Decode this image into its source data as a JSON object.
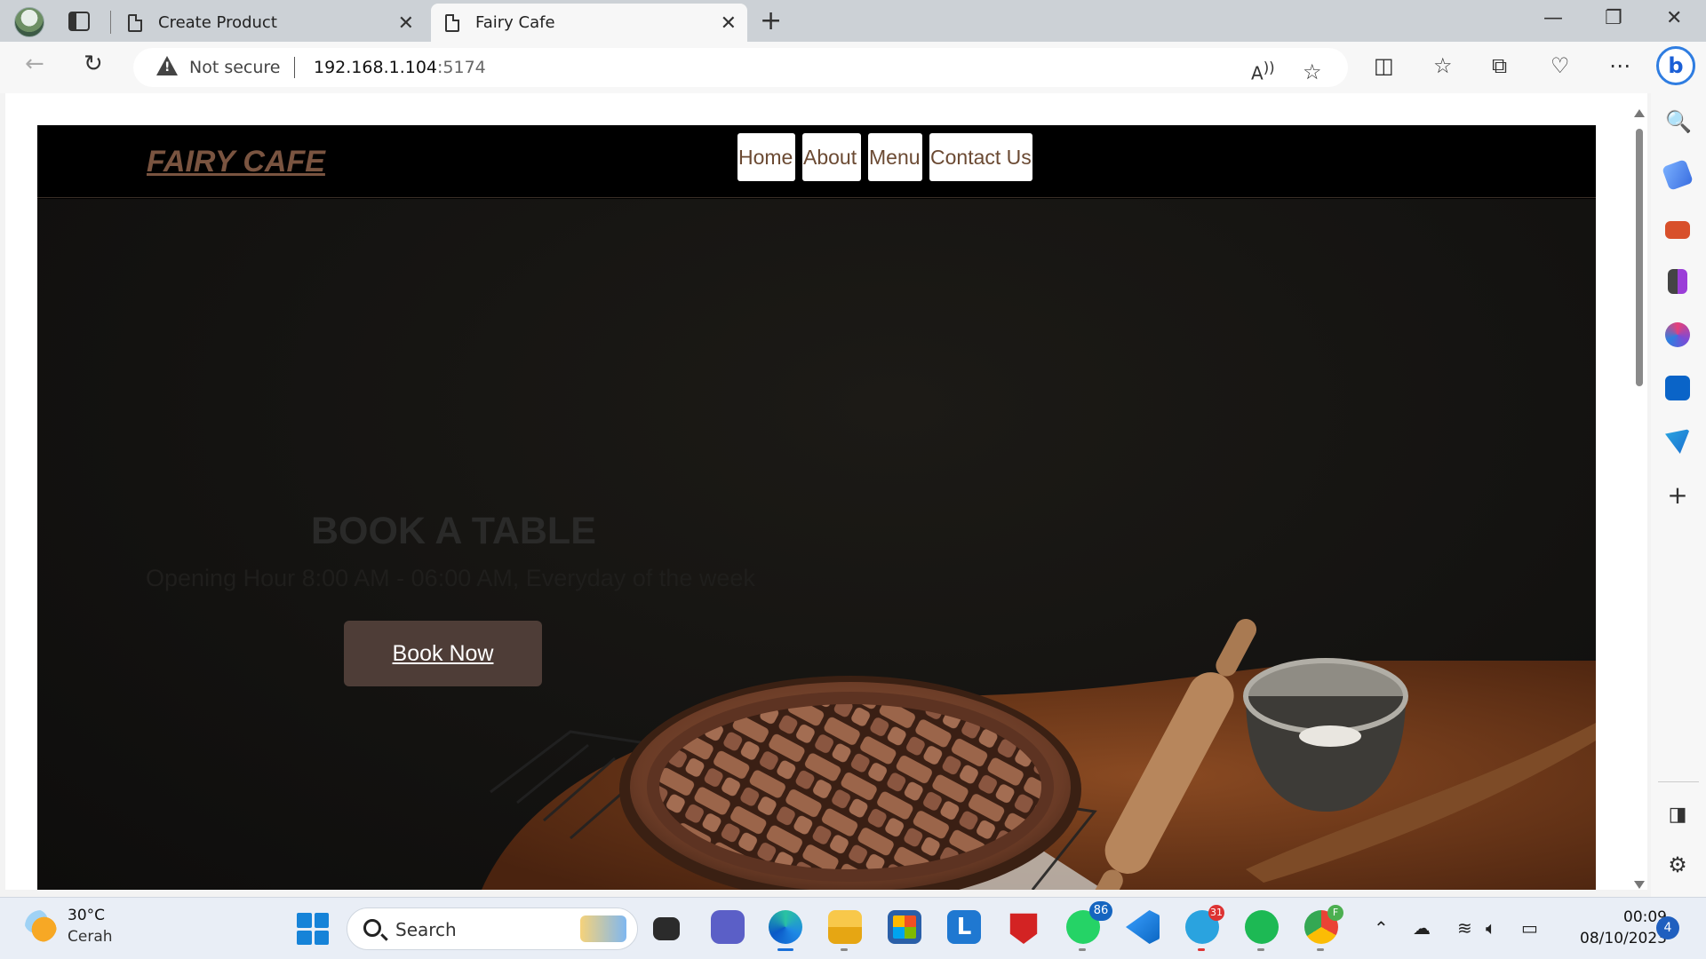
{
  "browser": {
    "tabs": [
      {
        "title": "Create Product",
        "active": false
      },
      {
        "title": "Fairy Cafe",
        "active": true
      }
    ],
    "security_label": "Not secure",
    "url_host": "192.168.1.104",
    "url_port": ":5174",
    "bing_label": "b"
  },
  "site": {
    "logo": "FAIRY CAFE",
    "nav": [
      "Home",
      "About",
      "Menu",
      "Contact Us"
    ],
    "hero": {
      "heading": "BOOK A TABLE",
      "subtext": "Opening Hour 8:00 AM - 06:00 AM, Everyday of the week",
      "button": "Book Now"
    },
    "colors": {
      "brand": "#7a5440",
      "button": "#4e3d37",
      "nav_text": "#6b4a33"
    }
  },
  "taskbar": {
    "temperature": "30°C",
    "condition": "Cerah",
    "search_label": "Search",
    "whatsapp_badge": "86",
    "telegram_badge": "31",
    "chrome_profile": "F",
    "time": "00:09",
    "date": "08/10/2023",
    "notifications": "4"
  }
}
